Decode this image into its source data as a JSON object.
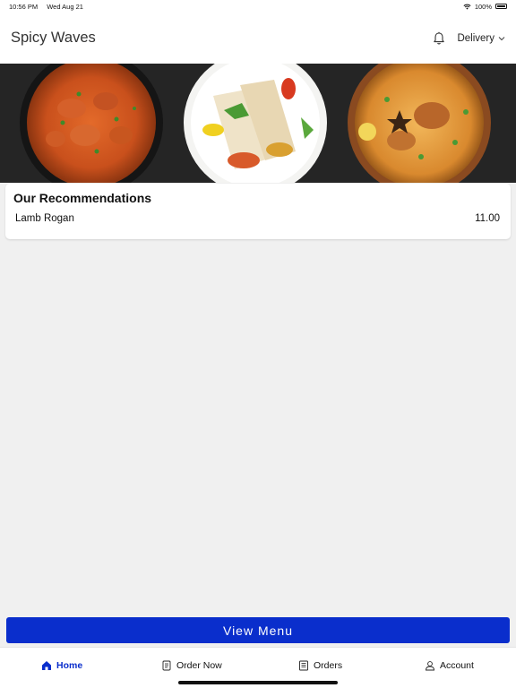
{
  "status": {
    "time": "10:56 PM",
    "date": "Wed Aug 21",
    "battery": "100%"
  },
  "header": {
    "title": "Spicy Waves",
    "mode": "Delivery"
  },
  "recommendations": {
    "title": "Our Recommendations",
    "items": [
      {
        "name": "Lamb Rogan",
        "price": "11.00"
      }
    ]
  },
  "cta": {
    "label": "View Menu"
  },
  "nav": {
    "home": "Home",
    "order_now": "Order Now",
    "orders": "Orders",
    "account": "Account"
  },
  "colors": {
    "accent": "#0a2ecc",
    "background": "#f0f0f0"
  },
  "icons": [
    "wifi-icon",
    "battery-icon",
    "bell-icon",
    "chevron-down-icon",
    "home-icon",
    "order-now-icon",
    "orders-icon",
    "account-icon"
  ]
}
